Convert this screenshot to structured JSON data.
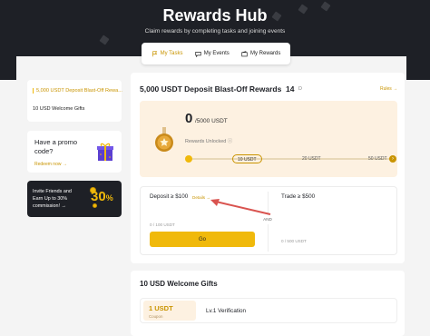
{
  "hero": {
    "title": "Rewards Hub",
    "subtitle": "Claim rewards by completing tasks and joining events"
  },
  "tabs": [
    {
      "label": "My Tasks",
      "icon": "flag-icon",
      "active": true
    },
    {
      "label": "My Events",
      "icon": "chat-icon",
      "active": false
    },
    {
      "label": "My Rewards",
      "icon": "wallet-icon",
      "active": false
    }
  ],
  "sidebar": {
    "items": [
      {
        "label": "5,000 USDT Deposit Blast-Off Rewa...",
        "active": true
      },
      {
        "label": "10 USD Welcome Gifts",
        "active": false
      }
    ]
  },
  "promo": {
    "question_line1": "Have a promo",
    "question_line2": "code?",
    "link": "Redeem now →",
    "icon": "gift-box-icon"
  },
  "invite": {
    "line1": "Invite Friends and",
    "line2": "Earn Up to 30%",
    "line3": "commission! →",
    "percent": "30",
    "percent_sign": "%"
  },
  "campaign": {
    "title": "5,000 USDT Deposit Blast-Off Rewards",
    "days": "14",
    "days_unit": "D",
    "rules": "Rules →",
    "unlocked_amount": "0",
    "total": "/5000 USDT",
    "unlocked_label": "Rewards Unlocked ⓘ",
    "milestones": [
      "10 USDT",
      "20 USDT",
      "50 USDT"
    ],
    "milestone_next": "›",
    "progress": 0
  },
  "tasks": {
    "left": {
      "label": "Deposit ≥ $100",
      "details": "Details →",
      "progress": "0 / 100 USDT",
      "button": "Go"
    },
    "and": "AND",
    "right": {
      "label": "Trade ≥ $500",
      "progress": "0 / 500 USDT"
    }
  },
  "welcome": {
    "title": "10 USD Welcome Gifts",
    "coupon_amount": "1 USDT",
    "coupon_label": "Coupon",
    "task": "Lv.1 Verification"
  },
  "colors": {
    "accent": "#f0b90b",
    "accent_dark": "#c99400",
    "hero_bg": "#1e2026",
    "arrow": "#d9534f"
  }
}
